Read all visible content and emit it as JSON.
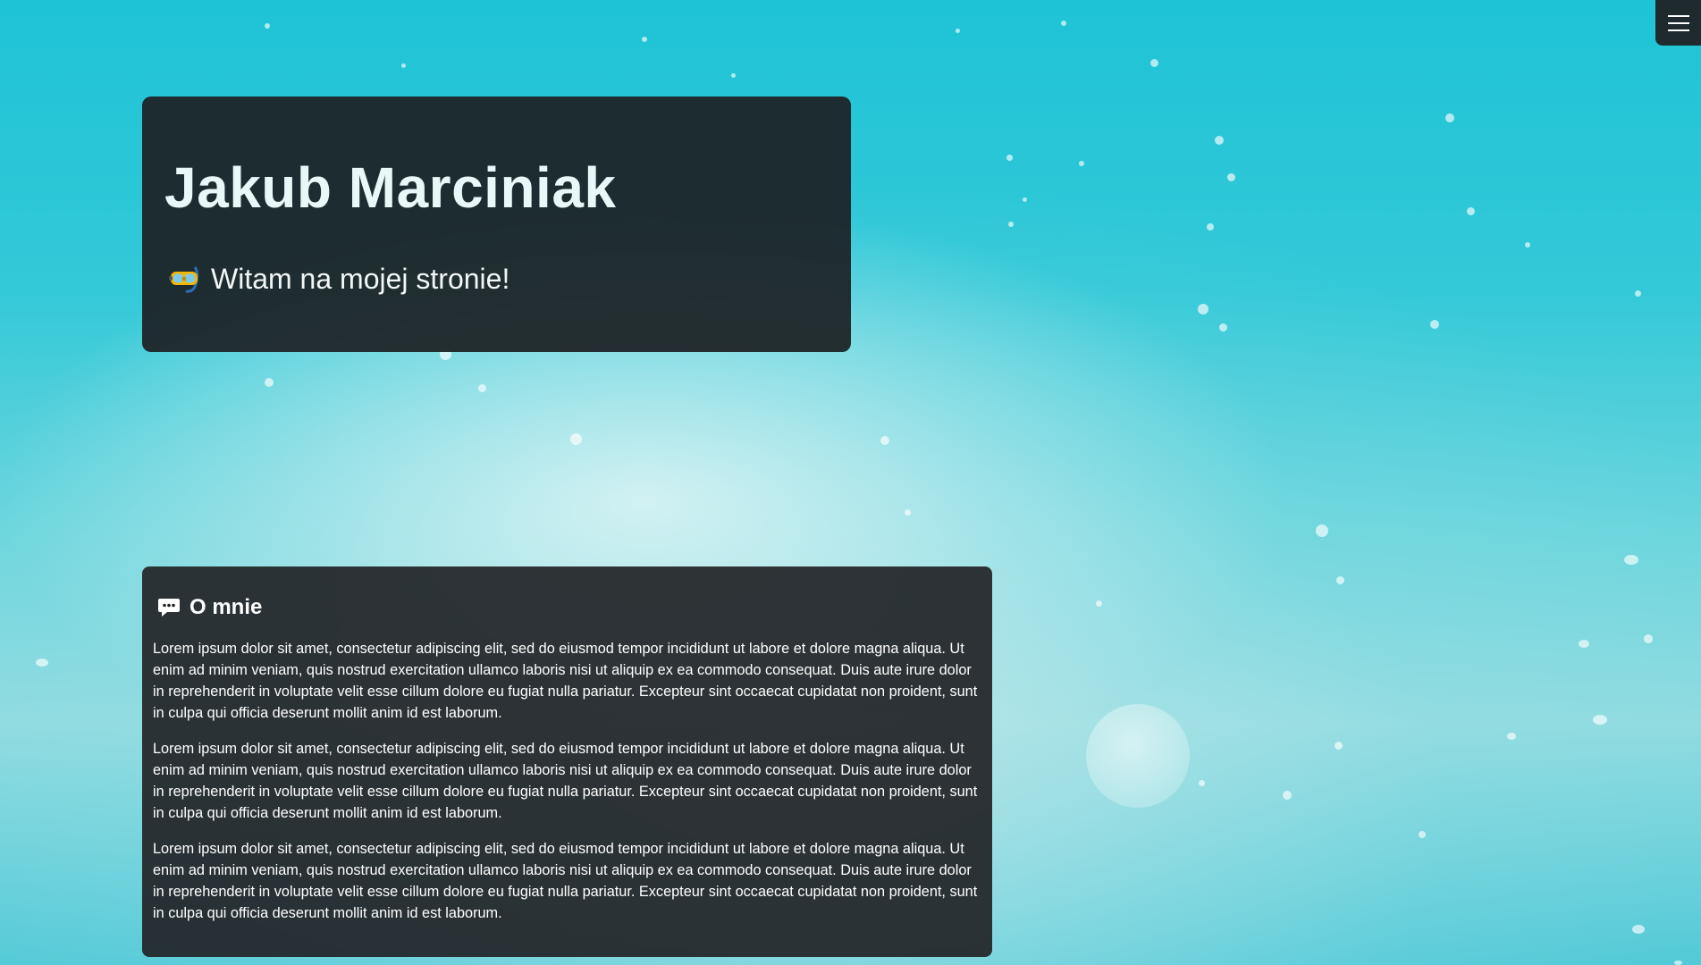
{
  "header": {
    "name": "Jakub Marciniak",
    "welcome": "Witam na mojej stronie!",
    "welcome_icon": "diving-mask-icon"
  },
  "menu": {
    "icon": "hamburger-menu-icon"
  },
  "about": {
    "heading": "O mnie",
    "heading_icon": "speech-bubble-icon",
    "paragraphs": [
      "Lorem ipsum dolor sit amet, consectetur adipiscing elit, sed do eiusmod tempor incididunt ut labore et dolore magna aliqua. Ut enim ad minim veniam, quis nostrud exercitation ullamco laboris nisi ut aliquip ex ea commodo consequat. Duis aute irure dolor in reprehenderit in voluptate velit esse cillum dolore eu fugiat nulla pariatur. Excepteur sint occaecat cupidatat non proident, sunt in culpa qui officia deserunt mollit anim id est laborum.",
      "Lorem ipsum dolor sit amet, consectetur adipiscing elit, sed do eiusmod tempor incididunt ut labore et dolore magna aliqua. Ut enim ad minim veniam, quis nostrud exercitation ullamco laboris nisi ut aliquip ex ea commodo consequat. Duis aute irure dolor in reprehenderit in voluptate velit esse cillum dolore eu fugiat nulla pariatur. Excepteur sint occaecat cupidatat non proident, sunt in culpa qui officia deserunt mollit anim id est laborum.",
      "Lorem ipsum dolor sit amet, consectetur adipiscing elit, sed do eiusmod tempor incididunt ut labore et dolore magna aliqua. Ut enim ad minim veniam, quis nostrud exercitation ullamco laboris nisi ut aliquip ex ea commodo consequat. Duis aute irure dolor in reprehenderit in voluptate velit esse cillum dolore eu fugiat nulla pariatur. Excepteur sint occaecat cupidatat non proident, sunt in culpa qui officia deserunt mollit anim id est laborum."
    ]
  },
  "colors": {
    "card_background": "#1f2326",
    "water_accent": "#1ec3d6",
    "text": "#ffffff"
  }
}
